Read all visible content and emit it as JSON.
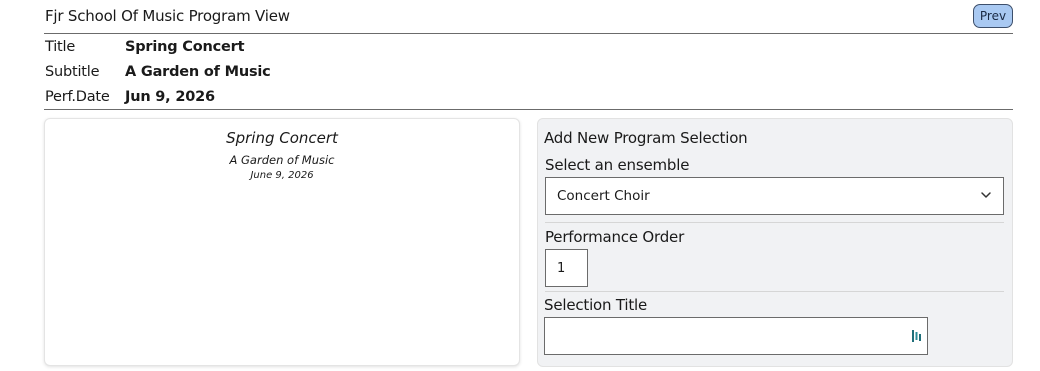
{
  "header": {
    "app_title": "Fjr School Of Music Program View",
    "prev_label": "Prev"
  },
  "meta": {
    "title_label": "Title",
    "title_value": "Spring Concert",
    "subtitle_label": "Subtitle",
    "subtitle_value": "A Garden of Music",
    "date_label": "Perf.Date",
    "date_value": "Jun 9, 2026"
  },
  "preview": {
    "title": "Spring Concert",
    "subtitle": "A Garden of Music",
    "date": "June 9, 2026"
  },
  "form": {
    "heading": "Add New Program Selection",
    "ensemble_label": "Select an ensemble",
    "ensemble_value": "Concert Choir",
    "order_label": "Performance Order",
    "order_value": "1",
    "selection_title_label": "Selection Title",
    "selection_title_value": ""
  },
  "icons": {
    "dropdown": "chevron-down-icon",
    "input_extension": "grammar-extension-icon"
  },
  "colors": {
    "prev_button_bg": "#a9c9f2",
    "panel_bg": "#f1f2f4",
    "extension_icon": "#1f6f7a"
  }
}
